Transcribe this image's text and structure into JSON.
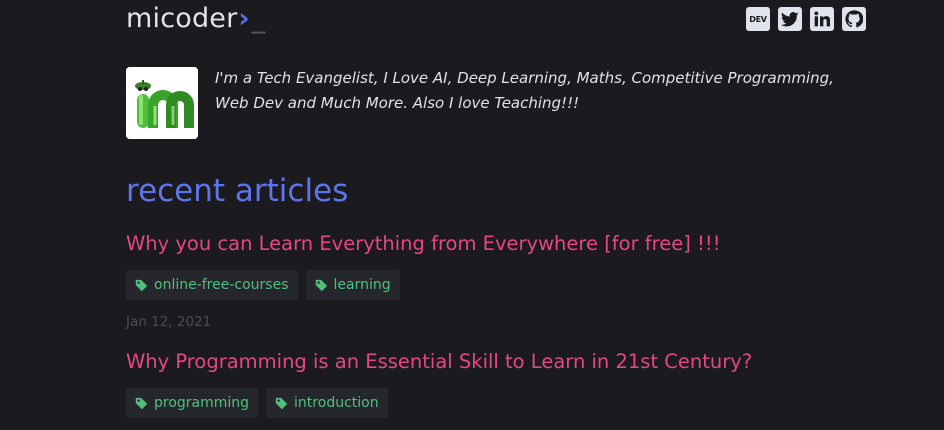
{
  "header": {
    "brand_text": "micoder",
    "brand_prompt": "›",
    "brand_cursor": "_",
    "social": [
      {
        "name": "dev-icon",
        "label": "DEV"
      },
      {
        "name": "twitter-icon"
      },
      {
        "name": "linkedin-icon"
      },
      {
        "name": "github-icon"
      }
    ]
  },
  "profile": {
    "bio": "I'm a Tech Evangelist, I Love AI, Deep Learning, Maths, Competitive Programming, Web Dev and Much More. Also I love Teaching!!!"
  },
  "section_title": "recent articles",
  "articles": [
    {
      "title": "Why you can Learn Everything from Everywhere [for free] !!!",
      "tags": [
        "online-free-courses",
        "learning"
      ],
      "date": "Jan 12, 2021"
    },
    {
      "title": "Why Programming is an Essential Skill to Learn in 21st Century?",
      "tags": [
        "programming",
        "introduction"
      ]
    }
  ],
  "colors": {
    "background": "#1b1b1f",
    "accent": "#5f74ea",
    "article_title": "#e5487f",
    "tag_text": "#4ec07a"
  }
}
